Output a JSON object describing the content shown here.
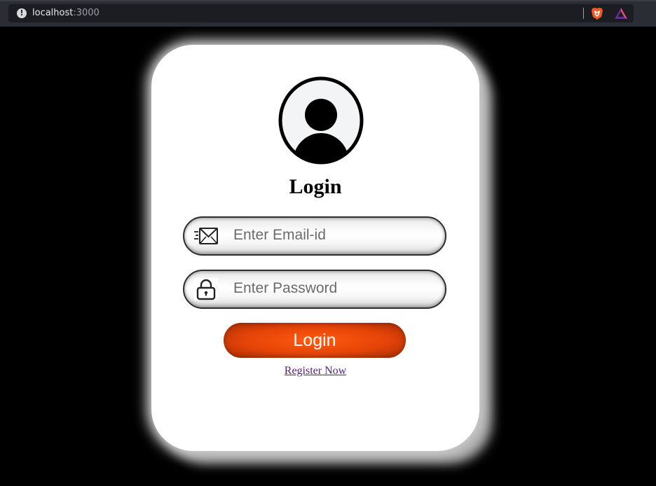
{
  "browser": {
    "url_host": "localhost",
    "url_port": ":3000"
  },
  "icons": {
    "info": "info-icon",
    "brave": "brave-lion-icon",
    "rewards": "brave-rewards-icon",
    "avatar": "user-avatar-icon",
    "email": "envelope-icon",
    "password": "lock-icon"
  },
  "login_form": {
    "title": "Login",
    "email_placeholder": "Enter Email-id",
    "password_placeholder": "Enter Password",
    "submit_label": "Login",
    "register_link": "Register Now"
  },
  "colors": {
    "accent": "#e54408",
    "link": "#551a8b",
    "background": "#000000",
    "card": "#ffffff"
  }
}
